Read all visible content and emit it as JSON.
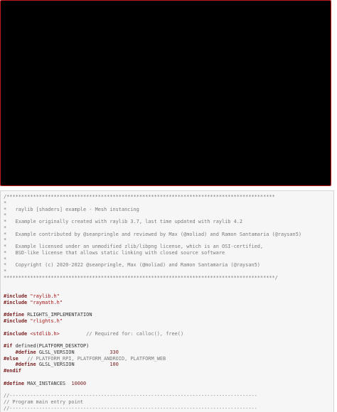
{
  "canvas": {
    "background": "#000000",
    "border_color": "#c21a1a"
  },
  "colors": {
    "comment": "#7a7a7a",
    "keyword": "#7a1f1f",
    "string": "#a31515",
    "text": "#333333",
    "panel_bg": "#f6f6f6"
  },
  "code": {
    "lines": [
      [
        {
          "t": "c",
          "v": "/*******************************************************************************************"
        }
      ],
      [
        {
          "t": "c",
          "v": "*"
        }
      ],
      [
        {
          "t": "c",
          "v": "*   raylib [shaders] example - Mesh instancing"
        }
      ],
      [
        {
          "t": "c",
          "v": "*"
        }
      ],
      [
        {
          "t": "c",
          "v": "*   Example originally created with raylib 3.7, last time updated with raylib 4.2"
        }
      ],
      [
        {
          "t": "c",
          "v": "*"
        }
      ],
      [
        {
          "t": "c",
          "v": "*   Example contributed by @seanpringle and reviewed by Max (@moliad) and Ramon Santamaria (@raysan5)"
        }
      ],
      [
        {
          "t": "c",
          "v": "*"
        }
      ],
      [
        {
          "t": "c",
          "v": "*   Example licensed under an unmodified zlib/libpng license, which is an OSI-certified,"
        }
      ],
      [
        {
          "t": "c",
          "v": "*   BSD-like license that allows static linking with closed source software"
        }
      ],
      [
        {
          "t": "c",
          "v": "*"
        }
      ],
      [
        {
          "t": "c",
          "v": "*   Copyright (c) 2020-2022 @seanpringle, Max (@moliad) and Ramon Santamaria (@raysan5)"
        }
      ],
      [
        {
          "t": "c",
          "v": "*"
        }
      ],
      [
        {
          "t": "c",
          "v": "********************************************************************************************/"
        }
      ],
      [],
      [],
      [
        {
          "t": "k",
          "v": "#include "
        },
        {
          "t": "s",
          "v": "\"raylib.h\""
        }
      ],
      [
        {
          "t": "k",
          "v": "#include "
        },
        {
          "t": "s",
          "v": "\"raymath.h\""
        }
      ],
      [],
      [
        {
          "t": "k",
          "v": "#define "
        },
        {
          "t": "x",
          "v": "RLIGHTS_IMPLEMENTATION"
        }
      ],
      [
        {
          "t": "k",
          "v": "#include "
        },
        {
          "t": "s",
          "v": "\"rlights.h\""
        }
      ],
      [],
      [
        {
          "t": "k",
          "v": "#include "
        },
        {
          "t": "s",
          "v": "<stdlib.h>"
        },
        {
          "t": "x",
          "v": "         "
        },
        {
          "t": "c",
          "v": "// Required for: calloc(), free()"
        }
      ],
      [],
      [
        {
          "t": "k",
          "v": "#if "
        },
        {
          "t": "x",
          "v": "defined(PLATFORM_DESKTOP)"
        }
      ],
      [
        {
          "t": "x",
          "v": "    "
        },
        {
          "t": "k",
          "v": "#define "
        },
        {
          "t": "x",
          "v": "GLSL_VERSION            "
        },
        {
          "t": "n",
          "v": "330"
        }
      ],
      [
        {
          "t": "k",
          "v": "#else"
        },
        {
          "t": "x",
          "v": "   "
        },
        {
          "t": "c",
          "v": "// PLATFORM_RPI, PLATFORM_ANDROID, PLATFORM_WEB"
        }
      ],
      [
        {
          "t": "x",
          "v": "    "
        },
        {
          "t": "k",
          "v": "#define "
        },
        {
          "t": "x",
          "v": "GLSL_VERSION            "
        },
        {
          "t": "n",
          "v": "100"
        }
      ],
      [
        {
          "t": "k",
          "v": "#endif"
        }
      ],
      [],
      [
        {
          "t": "k",
          "v": "#define "
        },
        {
          "t": "x",
          "v": "MAX_INSTANCES  "
        },
        {
          "t": "n",
          "v": "10000"
        }
      ],
      [],
      [
        {
          "t": "c",
          "v": "//------------------------------------------------------------------------------------"
        }
      ],
      [
        {
          "t": "c",
          "v": "// Program main entry point"
        }
      ],
      [
        {
          "t": "c",
          "v": "//------------------------------------------------------------------------------------"
        }
      ]
    ]
  }
}
